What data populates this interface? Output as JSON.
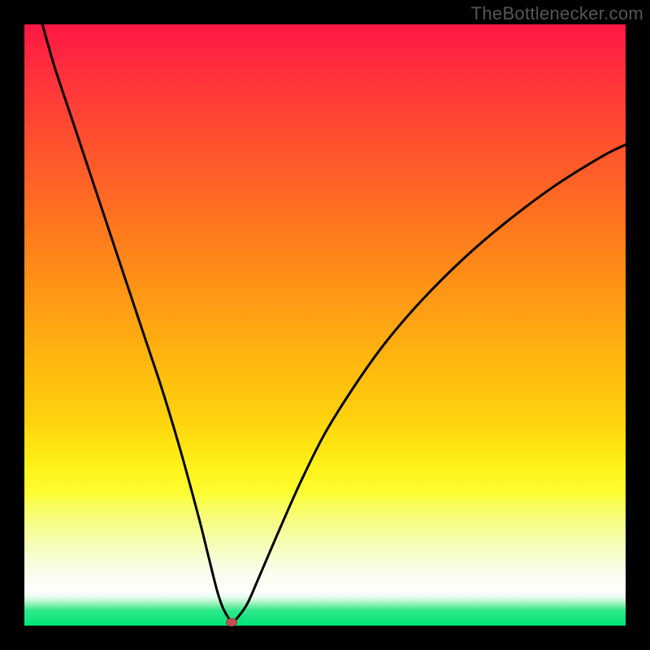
{
  "watermark": "TheBottlenecker.com",
  "chart_data": {
    "type": "line",
    "title": "",
    "xlabel": "",
    "ylabel": "",
    "xlim": [
      0,
      100
    ],
    "ylim": [
      0,
      100
    ],
    "grid": false,
    "legend": false,
    "background_gradient": {
      "top": "#ff1744",
      "mid": "#ffee00",
      "bottom": "#00e676"
    },
    "series": [
      {
        "name": "bottleneck-curve",
        "color": "#000000",
        "x": [
          3,
          5,
          8,
          11,
          14,
          17,
          20,
          23,
          26,
          29,
          30.5,
          32,
          33,
          34,
          34.5,
          35,
          37,
          39,
          42,
          46,
          50,
          55,
          60,
          66,
          73,
          80,
          88,
          96,
          100
        ],
        "y": [
          100,
          93,
          84,
          75,
          66,
          57,
          48,
          39,
          29,
          18,
          12,
          6,
          3,
          1.2,
          0.6,
          0.8,
          3.5,
          8,
          15,
          24,
          32,
          40,
          47,
          54,
          61,
          67,
          73,
          78,
          80
        ]
      }
    ],
    "marker": {
      "name": "optimal-point",
      "x": 34.5,
      "y": 0.6,
      "color": "#c0504d"
    }
  }
}
